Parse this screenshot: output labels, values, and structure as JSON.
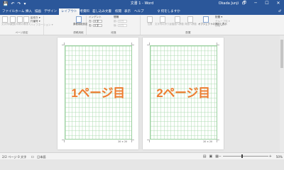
{
  "title_bar": {
    "quick_access": [
      "💾",
      "↶",
      "↷",
      "▾"
    ],
    "title": "文書 1 - Word",
    "user": "Okada Junji",
    "controls": [
      "🗗",
      "─",
      "☐",
      "✕"
    ]
  },
  "tabs": [
    "ファイル",
    "ホーム",
    "挿入",
    "描画",
    "デザイン",
    "レイアウト",
    "参考資料",
    "差し込み文書",
    "校閲",
    "表示",
    "ヘルプ"
  ],
  "active_tab": "レイアウト",
  "tell_me": "♀ 何をしますか",
  "share": "♂",
  "ribbon": {
    "page_setup": {
      "label": "ページ設定",
      "buttons": [
        "文字列の方向",
        "余白",
        "印刷の向き",
        "サイズ",
        "段組み"
      ],
      "small": [
        "区切り ▾",
        "行番号 ▾",
        "ハイフネーション ▾"
      ]
    },
    "genkou": {
      "label": "原稿用紙",
      "button": "原稿用紙設定"
    },
    "paragraph": {
      "label": "段落",
      "indent_label": "インデント",
      "spacing_label": "間隔",
      "left": "左:",
      "right": "右:",
      "before": "前:",
      "after": "後:",
      "left_val": "0 字",
      "right_val": "0 字",
      "before_val": "0 行",
      "after_val": "0 行"
    },
    "arrange": {
      "label": "配置",
      "buttons": [
        "位置",
        "文字列の折り返し",
        "前面へ移動",
        "背面へ移動",
        "オブジェクトの選択と表示"
      ],
      "small": [
        "配置 ▾",
        "グループ化 ▾",
        "回転 ▾"
      ]
    }
  },
  "pages": [
    {
      "label": "1ページ目",
      "footer": "20 × 20"
    },
    {
      "label": "2ページ目",
      "footer": "20 × 20"
    }
  ],
  "status": {
    "page": "2/2 ページ",
    "words": "0 文字",
    "proof": "☐",
    "lang": "日本語",
    "view_icons": [
      "▤",
      "▣",
      "▦"
    ],
    "zoom_minus": "−",
    "zoom_plus": "+",
    "zoom": "50%"
  }
}
